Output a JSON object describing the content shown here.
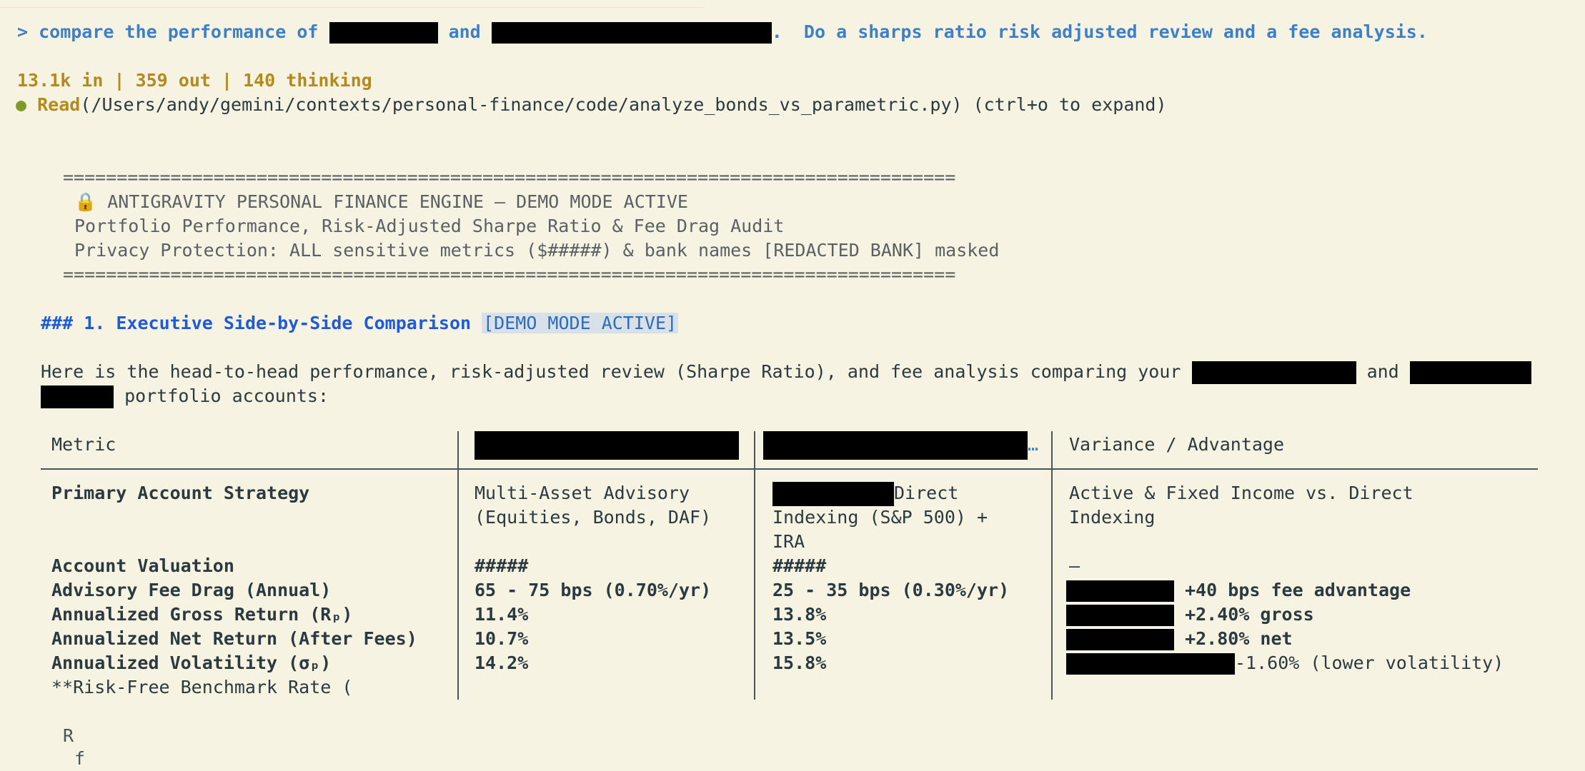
{
  "prompt": {
    "prefix": "> compare the performance of",
    "mid": "and",
    "suffix": ".  Do a sharps ratio risk adjusted review and a fee analysis."
  },
  "stats": "13.1k in | 359 out | 140 thinking",
  "tool": {
    "dot": "●",
    "name": "Read",
    "args": "(/Users/andy/gemini/contexts/personal-finance/code/analyze_bonds_vs_parametric.py) (ctrl+o to expand)"
  },
  "banner": {
    "rule": "===================================================================================",
    "lock_icon": "🔒",
    "title": "ANTIGRAVITY PERSONAL FINANCE ENGINE — DEMO MODE ACTIVE",
    "subtitle": "Portfolio Performance, Risk-Adjusted Sharpe Ratio & Fee Drag Audit",
    "privacy": "Privacy Protection: ALL sensitive metrics ($#####) & bank names [REDACTED BANK] masked"
  },
  "section": {
    "heading": "### 1. Executive Side-by-Side Comparison",
    "badge": "[DEMO MODE ACTIVE]"
  },
  "intro": {
    "line1": "Here is the head-to-head performance, risk-adjusted review (Sharpe Ratio), and fee analysis comparing your",
    "and": "and",
    "line2": "portfolio accounts:"
  },
  "table": {
    "header_metric": "Metric",
    "header_variance": "Variance / Advantage",
    "header_ellipsis": "…",
    "strategy": {
      "label": "Primary Account Strategy",
      "a1": "Multi-Asset Advisory",
      "a2": "(Equities, Bonds, DAF)",
      "b1": "Direct",
      "b2": "Indexing (S&P 500) +",
      "b3": "IRA",
      "v1": "Active & Fixed Income vs. Direct",
      "v2": "Indexing"
    },
    "rows": [
      {
        "label": "Account Valuation",
        "a": "#####",
        "b": "#####",
        "v": "–"
      },
      {
        "label": "Advisory Fee Drag (Annual)",
        "a": "65 - 75 bps (0.70%/yr)",
        "b": "25 - 35 bps (0.30%/yr)",
        "v": "+40 bps fee advantage"
      },
      {
        "label": "Annualized Gross Return (Rₚ)",
        "a": "11.4%",
        "b": "13.8%",
        "v": "+2.40% gross"
      },
      {
        "label": "Annualized Net Return (After Fees)",
        "a": "10.7%",
        "b": "13.5%",
        "v": "+2.80% net"
      },
      {
        "label": "Annualized Volatility (σₚ)",
        "a": "14.2%",
        "b": "15.8%",
        "v": "-1.60% (lower volatility)"
      }
    ],
    "last_label": "**Risk-Free Benchmark Rate ("
  },
  "trail": {
    "r": "R",
    "f": "f"
  }
}
